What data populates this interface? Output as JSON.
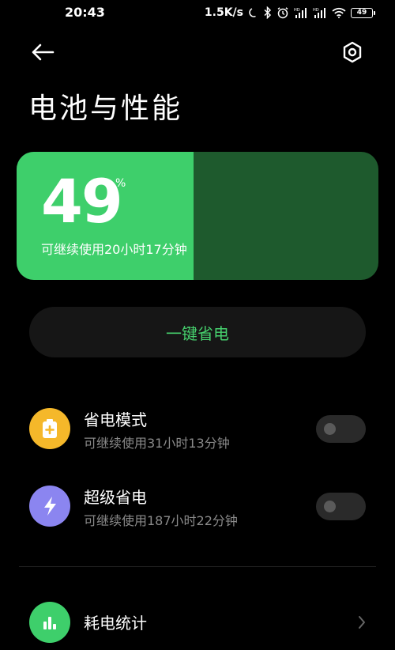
{
  "status_bar": {
    "time": "20:43",
    "net_speed": "1.5K/s",
    "battery_level": "49"
  },
  "header": {
    "title": "电池与性能"
  },
  "battery": {
    "percent_value": "49",
    "percent_symbol": "%",
    "level_fraction": 0.49,
    "remaining": "可继续使用20小时17分钟"
  },
  "one_tap": {
    "label": "一键省电"
  },
  "modes": [
    {
      "title": "省电模式",
      "subtitle": "可继续使用31小时13分钟",
      "icon": "battery-plus-icon",
      "icon_color": "#f5b82a",
      "enabled": false
    },
    {
      "title": "超级省电",
      "subtitle": "可继续使用187小时22分钟",
      "icon": "lightning-icon",
      "icon_color": "#8b85f0",
      "enabled": false
    }
  ],
  "stats": {
    "title": "耗电统计",
    "icon": "bar-chart-icon",
    "icon_color": "#3ecf6b"
  },
  "colors": {
    "accent_green": "#3ecf6b",
    "dark_green": "#1e5a2d",
    "button_text_green": "#46d06d"
  }
}
